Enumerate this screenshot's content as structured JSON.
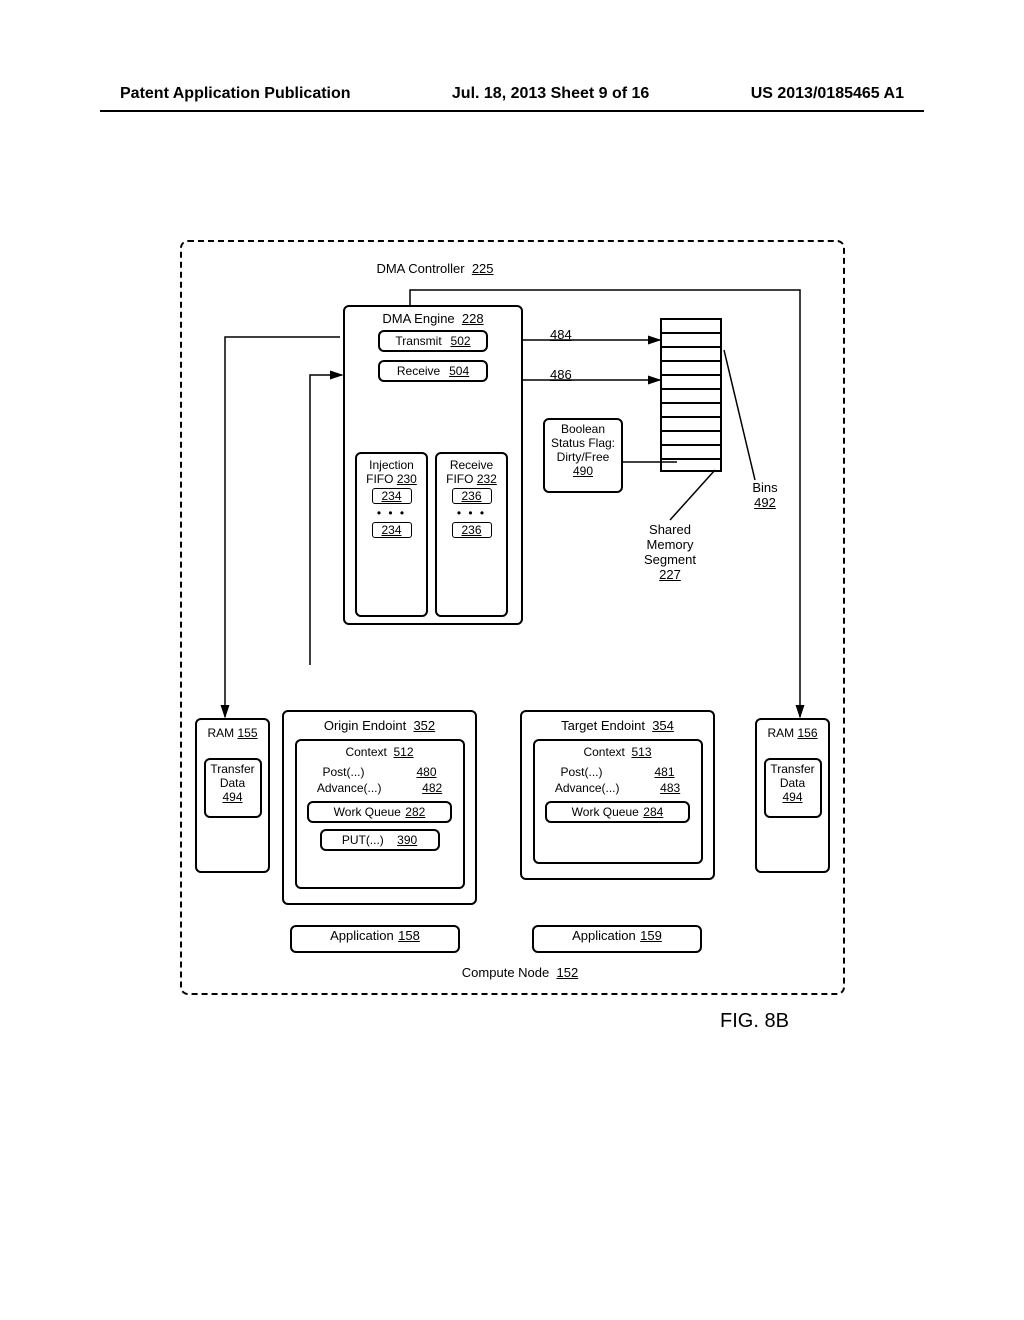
{
  "header": {
    "left": "Patent Application Publication",
    "center": "Jul. 18, 2013  Sheet 9 of 16",
    "right": "US 2013/0185465 A1"
  },
  "figure_label": "FIG. 8B",
  "dma_controller": {
    "label": "DMA Controller",
    "ref": "225"
  },
  "dma_engine": {
    "label": "DMA Engine",
    "ref": "228"
  },
  "transmit": {
    "label": "Transmit",
    "ref": "502"
  },
  "receive": {
    "label": "Receive",
    "ref": "504"
  },
  "arrow_484": "484",
  "arrow_486": "486",
  "injection_fifo": {
    "label": "Injection",
    "label2": "FIFO",
    "ref": "230",
    "entry": "234"
  },
  "receive_fifo": {
    "label": "Receive",
    "label2": "FIFO",
    "ref": "232",
    "entry": "236"
  },
  "status_flag": {
    "line1": "Boolean",
    "line2": "Status Flag:",
    "line3": "Dirty/Free",
    "ref": "490"
  },
  "shared_mem": {
    "line1": "Shared",
    "line2": "Memory",
    "line3": "Segment",
    "ref": "227"
  },
  "bins": {
    "label": "Bins",
    "ref": "492"
  },
  "ram_left": {
    "label": "RAM",
    "ref": "155"
  },
  "ram_right": {
    "label": "RAM",
    "ref": "156"
  },
  "transfer_data_left": {
    "line1": "Transfer",
    "line2": "Data",
    "ref": "494"
  },
  "transfer_data_right": {
    "line1": "Transfer",
    "line2": "Data",
    "ref": "494"
  },
  "origin_endpoint": {
    "label": "Origin Endoint",
    "ref": "352"
  },
  "target_endpoint": {
    "label": "Target Endoint",
    "ref": "354"
  },
  "context_origin": {
    "label": "Context",
    "ref": "512"
  },
  "context_target": {
    "label": "Context",
    "ref": "513"
  },
  "post_origin": {
    "label": "Post(...)",
    "ref": "480"
  },
  "advance_origin": {
    "label": "Advance(...)",
    "ref": "482"
  },
  "post_target": {
    "label": "Post(...)",
    "ref": "481"
  },
  "advance_target": {
    "label": "Advance(...)",
    "ref": "483"
  },
  "work_queue_origin": {
    "label": "Work Queue",
    "ref": "282"
  },
  "work_queue_target": {
    "label": "Work Queue",
    "ref": "284"
  },
  "put": {
    "label": "PUT(...)",
    "ref": "390"
  },
  "app_origin": {
    "label": "Application",
    "ref": "158"
  },
  "app_target": {
    "label": "Application",
    "ref": "159"
  },
  "compute_node": {
    "label": "Compute Node",
    "ref": "152"
  }
}
